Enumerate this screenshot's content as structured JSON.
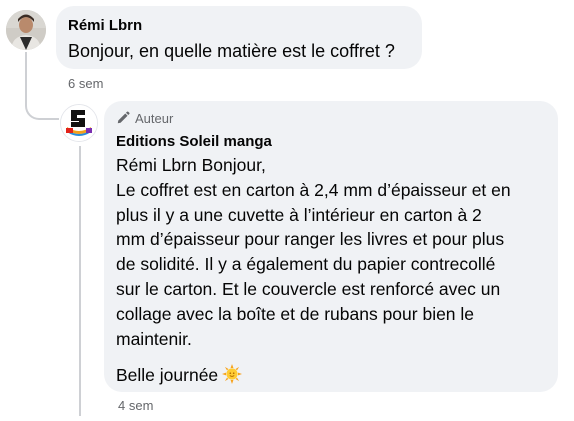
{
  "comment": {
    "author": "Rémi Lbrn",
    "text": "Bonjour, en quelle matière est le coffret ?",
    "time": "6 sem"
  },
  "reply": {
    "badge": "Auteur",
    "badge_icon": "pencil-icon",
    "author": "Editions Soleil manga",
    "lines": [
      "Rémi Lbrn Bonjour,",
      "Le coffret est en carton à 2,4 mm d’épaisseur et en",
      "plus il y a une cuvette à l’intérieur en carton à 2",
      "mm d’épaisseur pour ranger les livres et pour plus",
      "de solidité. Il y a également du papier contrecollé",
      "sur le carton. Et le couvercle est renforcé avec un",
      "collage avec la boîte et de rubans pour bien le",
      "maintenir."
    ],
    "closing": "Belle journée",
    "closing_emoji": "sun-emoji",
    "time": "4 sem",
    "avatar_text": "SOLEIL"
  },
  "colors": {
    "bubble": "#f0f2f5",
    "secondary_text": "#65676b",
    "connector": "#ced0d4",
    "soleil_red": "#e2231a"
  }
}
